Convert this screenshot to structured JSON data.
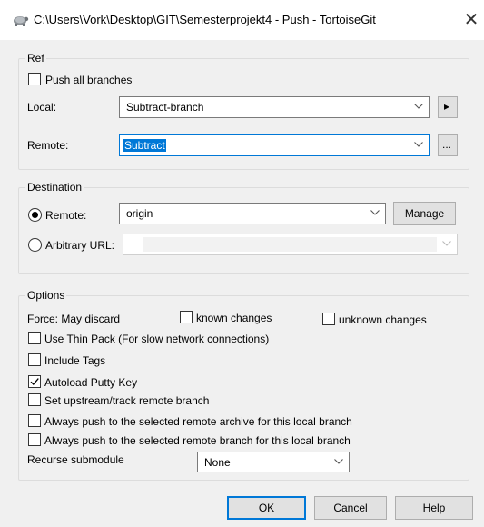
{
  "window": {
    "title": "C:\\Users\\Vork\\Desktop\\GIT\\Semesterprojekt4 - Push - TortoiseGit",
    "close_symbol": "✕",
    "app_icon": "tortoisegit-icon"
  },
  "ref": {
    "group_label": "Ref",
    "push_all_branches": {
      "label": "Push all branches",
      "checked": false
    },
    "local": {
      "label": "Local:",
      "value": "Subtract-branch",
      "side_button": "▸"
    },
    "remote": {
      "label": "Remote:",
      "value": "Subtract",
      "side_button": "..."
    }
  },
  "destination": {
    "group_label": "Destination",
    "remote": {
      "label": "Remote:",
      "value": "origin",
      "selected": true
    },
    "manage_label": "Manage",
    "arbitrary_url": {
      "label": "Arbitrary URL:",
      "value": "",
      "selected": false
    }
  },
  "options": {
    "group_label": "Options",
    "force_label": "Force: May discard",
    "known_changes": {
      "label": "known changes",
      "checked": false
    },
    "unknown_changes": {
      "label": "unknown changes",
      "checked": false
    },
    "use_thin_pack": {
      "label": "Use Thin Pack (For slow network connections)",
      "checked": false
    },
    "include_tags": {
      "label": "Include Tags",
      "checked": false
    },
    "autoload_putty_key": {
      "label": "Autoload Putty Key",
      "checked": true
    },
    "set_upstream": {
      "label": "Set upstream/track remote branch",
      "checked": false
    },
    "always_push_archive": {
      "label": "Always push to the selected remote archive for this local branch",
      "checked": false
    },
    "always_push_branch": {
      "label": "Always push to the selected remote branch for this local branch",
      "checked": false
    },
    "recurse_submodule": {
      "label": "Recurse submodule",
      "value": "None"
    }
  },
  "buttons": {
    "ok": "OK",
    "cancel": "Cancel",
    "help": "Help"
  },
  "colors": {
    "accent": "#0078d7",
    "background": "#f0f0f0"
  }
}
